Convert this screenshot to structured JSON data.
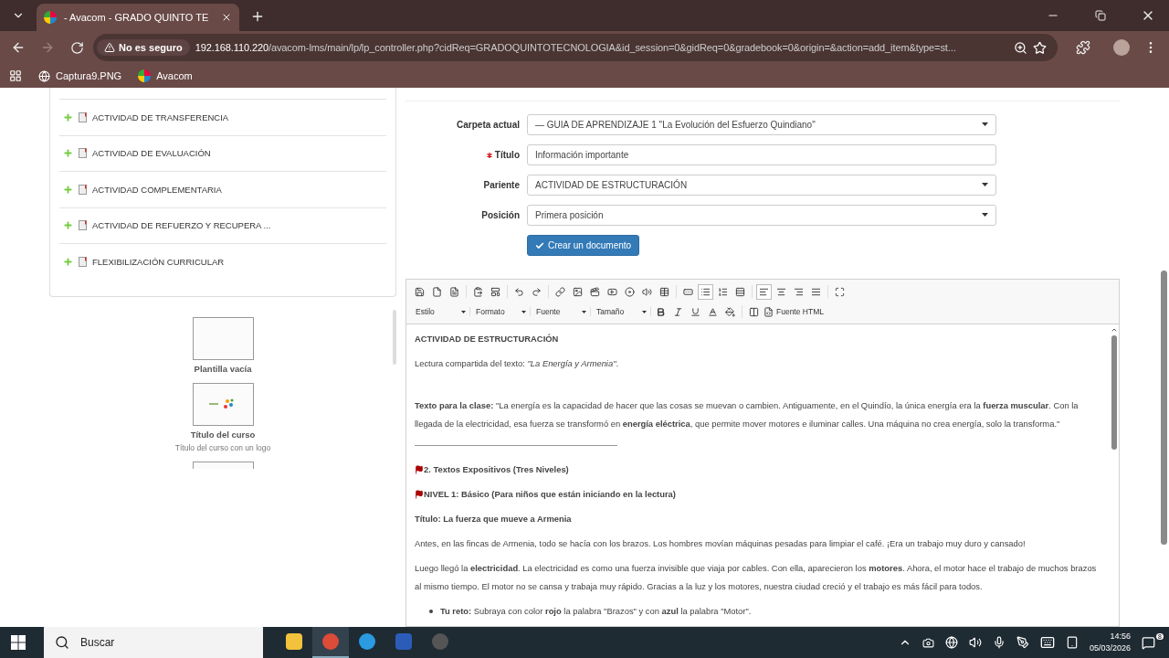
{
  "browser": {
    "tabs": [
      {
        "title": "- Avacom - GRADO QUINTO TE",
        "selected": true
      }
    ],
    "security": "No es seguro",
    "url_host": "192.168.110.220",
    "url_path": "/avacom-lms/main/lp/lp_controller.php?cidReq=GRADOQUINTOTECNOLOGIA&id_session=0&gidReq=0&gradebook=0&origin=&action=add_item&type=st...",
    "bookmarks": [
      {
        "label": "Captura9.PNG",
        "kind": "globe"
      },
      {
        "label": "Avacom",
        "kind": "site"
      }
    ]
  },
  "sidebar": {
    "items": [
      {
        "label": "ACTIVIDAD DE TRANSFERENCIA"
      },
      {
        "label": "ACTIVIDAD DE EVALUACIÓN"
      },
      {
        "label": "ACTIVIDAD COMPLEMENTARIA"
      },
      {
        "label": "ACTIVIDAD DE REFUERZO Y RECUPERA ..."
      },
      {
        "label": "FLEXIBILIZACIÓN CURRICULAR"
      }
    ]
  },
  "templates": [
    {
      "title": "Plantilla vacía",
      "kind": "blank"
    },
    {
      "title": "Título del curso",
      "subtitle": "Título del curso con un logo",
      "kind": "logo"
    },
    {
      "kind": "cut"
    }
  ],
  "form": {
    "fields": [
      {
        "label": "Carpeta actual",
        "required": false,
        "kind": "select",
        "value": "— GUIA DE APRENDIZAJE 1 \"La Evolución del Esfuerzo Quindiano\""
      },
      {
        "label": "Título",
        "required": true,
        "kind": "text",
        "value": "Información importante"
      },
      {
        "label": "Pariente",
        "required": false,
        "kind": "select",
        "value": "ACTIVIDAD DE ESTRUCTURACIÓN"
      },
      {
        "label": "Posición",
        "required": false,
        "kind": "select",
        "value": "Primera posición"
      }
    ],
    "submit": "Crear un documento"
  },
  "editor": {
    "tools": [
      {
        "kind": "save",
        "selected": false
      },
      {
        "kind": "new",
        "selected": false
      },
      {
        "kind": "preview",
        "selected": false
      },
      {
        "kind": "sep"
      },
      {
        "kind": "paste",
        "selected": false
      },
      {
        "kind": "template",
        "selected": false
      },
      {
        "kind": "sep"
      },
      {
        "kind": "undo",
        "selected": false
      },
      {
        "kind": "redo",
        "selected": false
      },
      {
        "kind": "sep"
      },
      {
        "kind": "link",
        "selected": false
      },
      {
        "kind": "image",
        "selected": false
      },
      {
        "kind": "video",
        "selected": false
      },
      {
        "kind": "youtube",
        "selected": false
      },
      {
        "kind": "flash",
        "selected": false
      },
      {
        "kind": "audio",
        "selected": false
      },
      {
        "kind": "table",
        "selected": false
      },
      {
        "kind": "sep"
      },
      {
        "kind": "form",
        "selected": false
      },
      {
        "kind": "bullets",
        "selected": true
      },
      {
        "kind": "numbers",
        "selected": false
      },
      {
        "kind": "rule",
        "selected": false
      },
      {
        "kind": "sep"
      },
      {
        "kind": "left",
        "selected": true
      },
      {
        "kind": "center",
        "selected": false
      },
      {
        "kind": "right",
        "selected": false
      },
      {
        "kind": "justify",
        "selected": false
      },
      {
        "kind": "sep"
      },
      {
        "kind": "maximize",
        "selected": false
      }
    ],
    "dropdowns": [
      "Estilo",
      "Formato",
      "Fuente",
      "Tamaño"
    ],
    "source": "Fuente HTML",
    "content": [
      {
        "kind": "heading",
        "text": "ACTIVIDAD DE ESTRUCTURACIÓN"
      },
      {
        "kind": "para",
        "text": "Lectura compartida del texto: *\"La Energía y Armenia\"*."
      },
      {
        "kind": "spacer"
      },
      {
        "kind": "para",
        "text": "**Texto para la clase:** \"La energía es la capacidad de hacer que las cosas se muevan o cambien. Antiguamente, en el Quindío, la única energía era la **fuerza muscular**. Con la llegada de la electricidad, esa fuerza se transformó en **energía eléctrica**, que permite mover motores e iluminar calles. Una máquina no crea energía, solo la transforma.\""
      },
      {
        "kind": "rule"
      },
      {
        "kind": "flag",
        "text": "2. Textos Expositivos (Tres Niveles)"
      },
      {
        "kind": "flag",
        "text": "NIVEL 1: Básico (Para niños que están iniciando en la lectura)"
      },
      {
        "kind": "heading",
        "text": "Título: La fuerza que mueve a Armenia"
      },
      {
        "kind": "para",
        "text": "Antes, en las fincas de Armenia, todo se hacía con los brazos. Los hombres movían máquinas pesadas para limpiar el café. ¡Era un trabajo muy duro y cansado!"
      },
      {
        "kind": "para",
        "text": "Luego llegó la **electricidad**. La electricidad es como una fuerza invisible que viaja por cables. Con ella, aparecieron los **motores**. Ahora, el motor hace el trabajo de muchos brazos al mismo tiempo. El motor no se cansa y trabaja muy rápido. Gracias a la luz y los motores, nuestra ciudad creció y el trabajo es más fácil para todos."
      },
      {
        "kind": "bullet",
        "text": "**Tu reto:** Subraya con color **rojo** la palabra \"Brazos\" y con **azul** la palabra \"Motor\"."
      }
    ]
  },
  "taskbar": {
    "search": "Buscar",
    "time": "14:56",
    "date": "05/03/2026",
    "notifications": "8"
  }
}
